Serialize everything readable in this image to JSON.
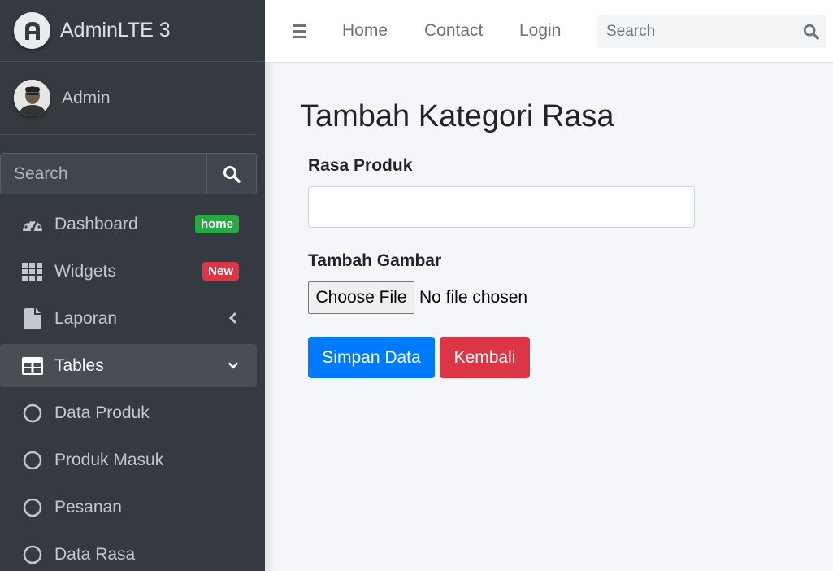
{
  "brand": {
    "title": "AdminLTE 3",
    "logo_icon": "adminlte-logo-icon"
  },
  "user": {
    "name": "Admin",
    "avatar_icon": "user-avatar"
  },
  "sidebar": {
    "search_placeholder": "Search",
    "items": [
      {
        "label": "Dashboard",
        "icon": "tachometer-icon",
        "badge": "home",
        "badge_color": "#28a745"
      },
      {
        "label": "Widgets",
        "icon": "grid-icon",
        "badge": "New",
        "badge_color": "#dc3545"
      },
      {
        "label": "Laporan",
        "icon": "file-icon",
        "arrow": "chevron-left"
      },
      {
        "label": "Tables",
        "icon": "table-icon",
        "arrow": "chevron-down",
        "active": true
      },
      {
        "label": "Data Produk",
        "icon": "circle-icon"
      },
      {
        "label": "Produk Masuk",
        "icon": "circle-icon"
      },
      {
        "label": "Pesanan",
        "icon": "circle-icon"
      },
      {
        "label": "Data Rasa",
        "icon": "circle-icon"
      }
    ]
  },
  "topbar": {
    "links": [
      "Home",
      "Contact",
      "Login"
    ],
    "search_placeholder": "Search"
  },
  "form": {
    "title": "Tambah Kategori Rasa",
    "field1_label": "Rasa Produk",
    "field1_value": "",
    "field2_label": "Tambah Gambar",
    "file_button": "Choose File",
    "file_status": "No file chosen",
    "save_button": "Simpan Data",
    "back_button": "Kembali"
  },
  "colors": {
    "sidebar_bg": "#343a40",
    "primary": "#007bff",
    "danger": "#dc3545",
    "success": "#28a745",
    "content_bg": "#f4f6f9"
  }
}
